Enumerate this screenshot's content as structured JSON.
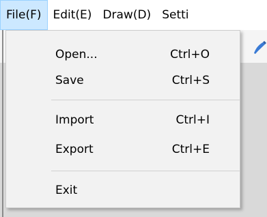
{
  "menubar": {
    "items": [
      {
        "label": "File(F)",
        "active": true
      },
      {
        "label": "Edit(E)",
        "active": false
      },
      {
        "label": "Draw(D)",
        "active": false
      },
      {
        "label": "Setti",
        "active": false
      }
    ]
  },
  "file_menu": {
    "items": [
      {
        "label": "Open...",
        "shortcut": "Ctrl+O"
      },
      {
        "label": "Save",
        "shortcut": "Ctrl+S"
      },
      {
        "label": "Import",
        "shortcut": "Ctrl+I"
      },
      {
        "label": "Export",
        "shortcut": "Ctrl+E"
      },
      {
        "label": "Exit",
        "shortcut": ""
      }
    ]
  },
  "toolbar": {
    "pen_icon": "pen-icon"
  },
  "colors": {
    "menubar_active_bg": "#cce8ff",
    "menubar_active_border": "#99d1ff",
    "menu_bg": "#f2f2f2",
    "workspace_bg": "#d9d9d9",
    "pen_icon": "#3a7bd5"
  }
}
